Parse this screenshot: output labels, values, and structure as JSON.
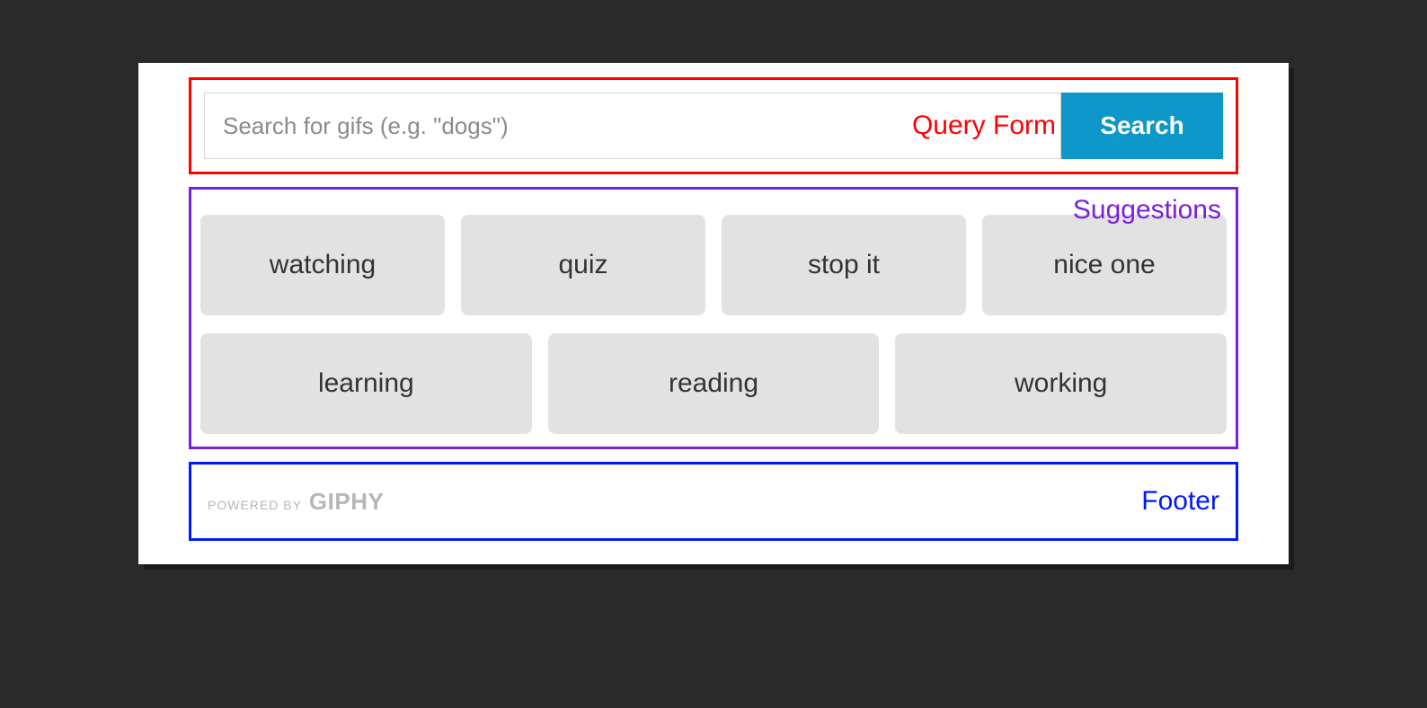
{
  "sections": {
    "queryForm": {
      "label": "Query Form"
    },
    "suggestions": {
      "label": "Suggestions"
    },
    "footer": {
      "label": "Footer"
    }
  },
  "search": {
    "placeholder": "Search for gifs (e.g. \"dogs\")",
    "buttonLabel": "Search",
    "value": ""
  },
  "suggestions": {
    "row1": [
      "watching",
      "quiz",
      "stop it",
      "nice one"
    ],
    "row2": [
      "learning",
      "reading",
      "working"
    ]
  },
  "footer": {
    "poweredByText": "POWERED BY",
    "brand": "GIPHY"
  },
  "colors": {
    "queryFormBorder": "#ff0000",
    "suggestionsBorder": "#7a1fe0",
    "footerBorder": "#0018ff",
    "searchButton": "#0d97c9",
    "chipBackground": "#e2e2e2"
  }
}
